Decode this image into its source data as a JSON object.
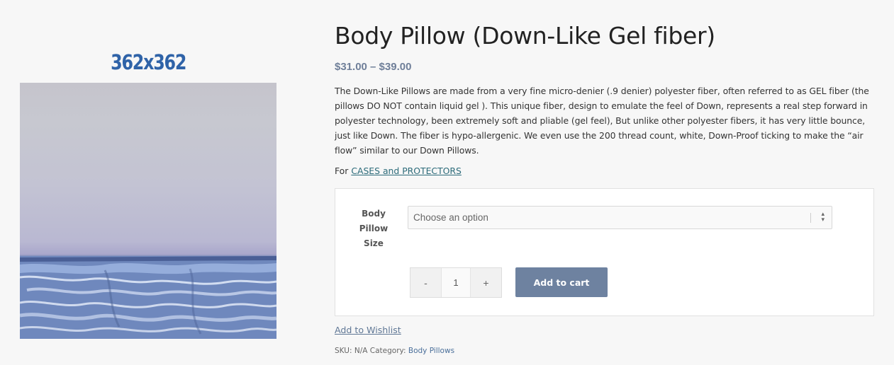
{
  "gallery": {
    "image_label": "362x362",
    "image_alt": "Body Pillow product image"
  },
  "product": {
    "title": "Body Pillow (Down-Like Gel fiber)",
    "price_range": "$31.00 – $39.00",
    "description": "The Down-Like Pillows are made from a very fine micro-denier (.9 denier) polyester fiber, often referred to as GEL fiber  (the pillows DO NOT contain liquid gel ).   This unique fiber, design to  emulate the feel of Down, represents a real step forward in polyester technology, been extremely soft and pliable (gel feel),  But unlike other polyester fibers, it has very little bounce, just like Down. The fiber is hypo-allergenic. We even use the 200 thread count, white, Down-Proof ticking to make the “air flow” similar to our Down Pillows.",
    "cases_prefix": "For ",
    "cases_link": "CASES and PROTECTORS"
  },
  "cart": {
    "size_label_line1": "Body",
    "size_label_line2": "Pillow",
    "size_label_line3": "Size",
    "select_placeholder": "Choose an option",
    "minus_label": "-",
    "quantity": "1",
    "plus_label": "+",
    "add_to_cart_label": "Add to cart"
  },
  "wishlist_label": "Add to Wishlist",
  "meta": {
    "sku_label": "SKU:",
    "sku_value": "N/A",
    "category_label": "Category:",
    "category_value": "Body Pillows"
  },
  "colors": {
    "accent": "#6e82a0",
    "price": "#6f7f99",
    "link": "#2c6b7a",
    "image_label": "#2f63a8"
  }
}
